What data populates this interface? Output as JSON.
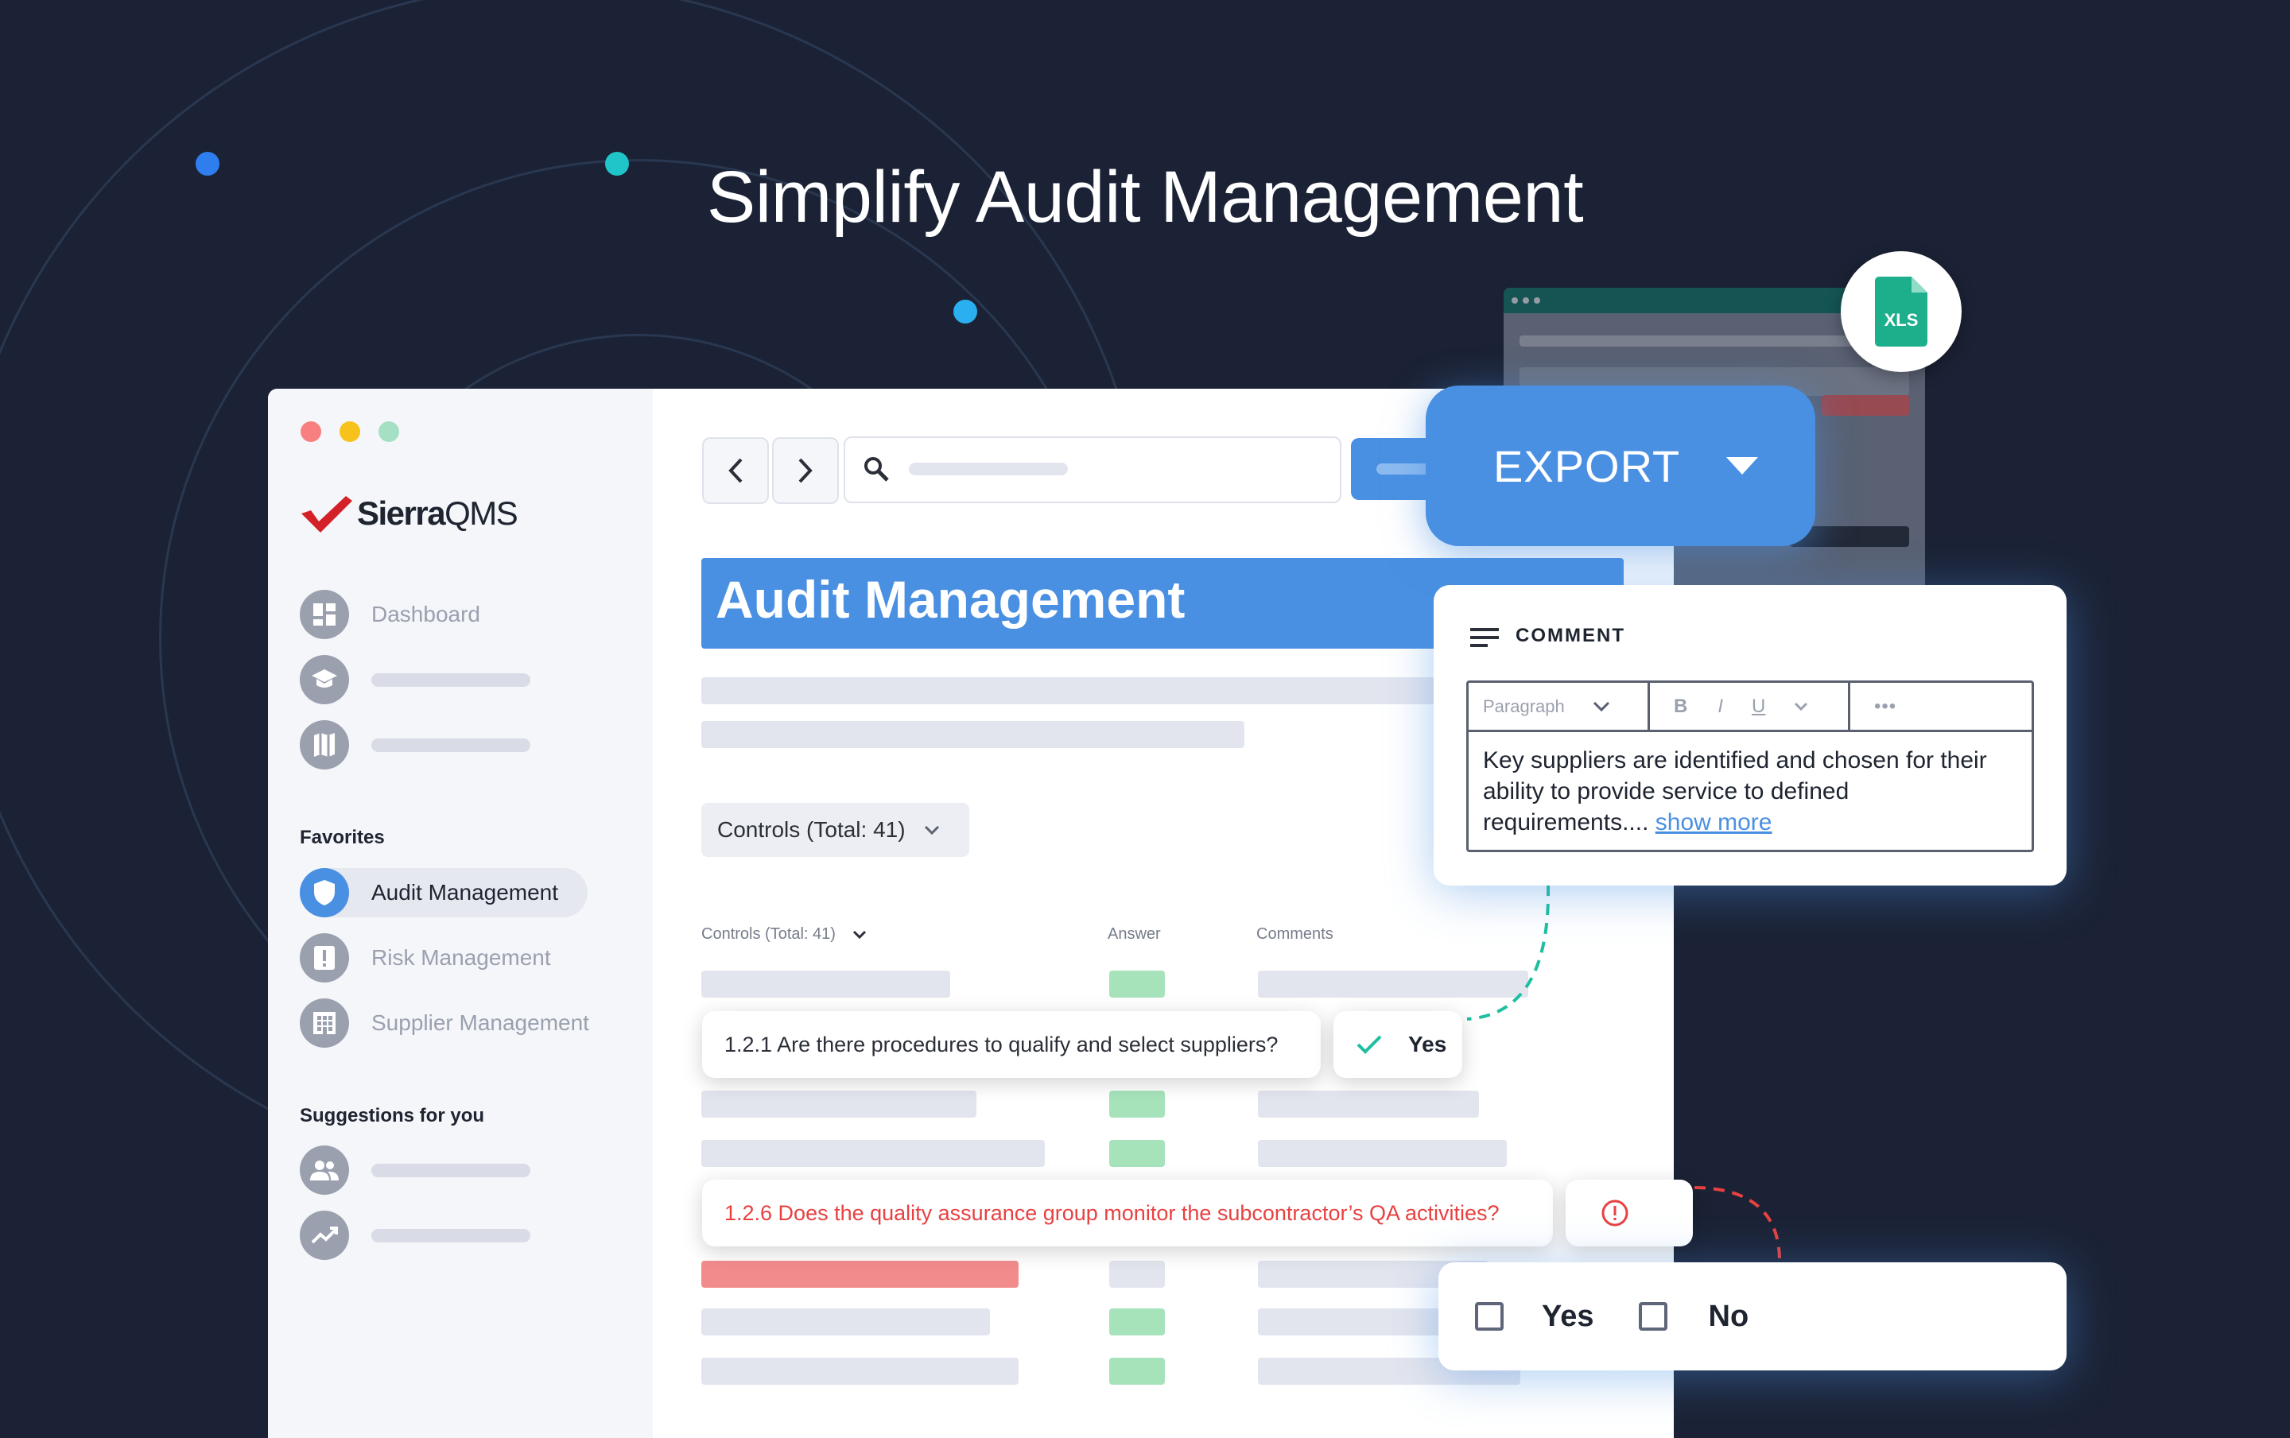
{
  "headline": "Simplify Audit Management",
  "colors": {
    "background": "#1b2235",
    "accent_blue": "#4a90e2",
    "teal": "#1dbfa0",
    "error_red": "#e84141",
    "answer_green": "#a6e3bb"
  },
  "sidebar": {
    "logo": {
      "brand_bold": "Sierra",
      "brand_light": "QMS",
      "icon": "check-logo-icon"
    },
    "items": [
      {
        "label": "Dashboard",
        "icon": "dashboard-icon"
      },
      {
        "label": "",
        "icon": "graduation-cap-icon"
      },
      {
        "label": "",
        "icon": "map-icon"
      }
    ],
    "favorites_title": "Favorites",
    "favorites": [
      {
        "label": "Audit Management",
        "icon": "shield-icon",
        "active": true
      },
      {
        "label": "Risk Management",
        "icon": "alert-icon"
      },
      {
        "label": "Supplier Management",
        "icon": "building-icon"
      }
    ],
    "suggestions_title": "Suggestions for you",
    "suggestions": [
      {
        "label": "",
        "icon": "people-icon"
      },
      {
        "label": "",
        "icon": "trend-icon"
      }
    ]
  },
  "main": {
    "title": "Audit Management",
    "controls_dropdown": "Controls (Total: 41)",
    "table": {
      "col_controls": "Controls (Total: 41)",
      "col_answer": "Answer",
      "col_comments": "Comments"
    },
    "question_1": "1.2.1 Are there procedures to qualify and select suppliers?",
    "answer_1": "Yes",
    "question_2": "1.2.6 Does the quality assurance group monitor the subcontractor’s QA activities?"
  },
  "export": {
    "label": "EXPORT",
    "file_badge": "XLS"
  },
  "comment": {
    "title": "COMMENT",
    "toolbar": {
      "format": "Paragraph",
      "bold": "B",
      "italic": "I",
      "underline": "U",
      "more": "•••"
    },
    "text": "Key suppliers are identified and chosen for their ability to provide service to defined requirements....",
    "link": "show more"
  },
  "answer_options": {
    "yes": "Yes",
    "no": "No"
  }
}
